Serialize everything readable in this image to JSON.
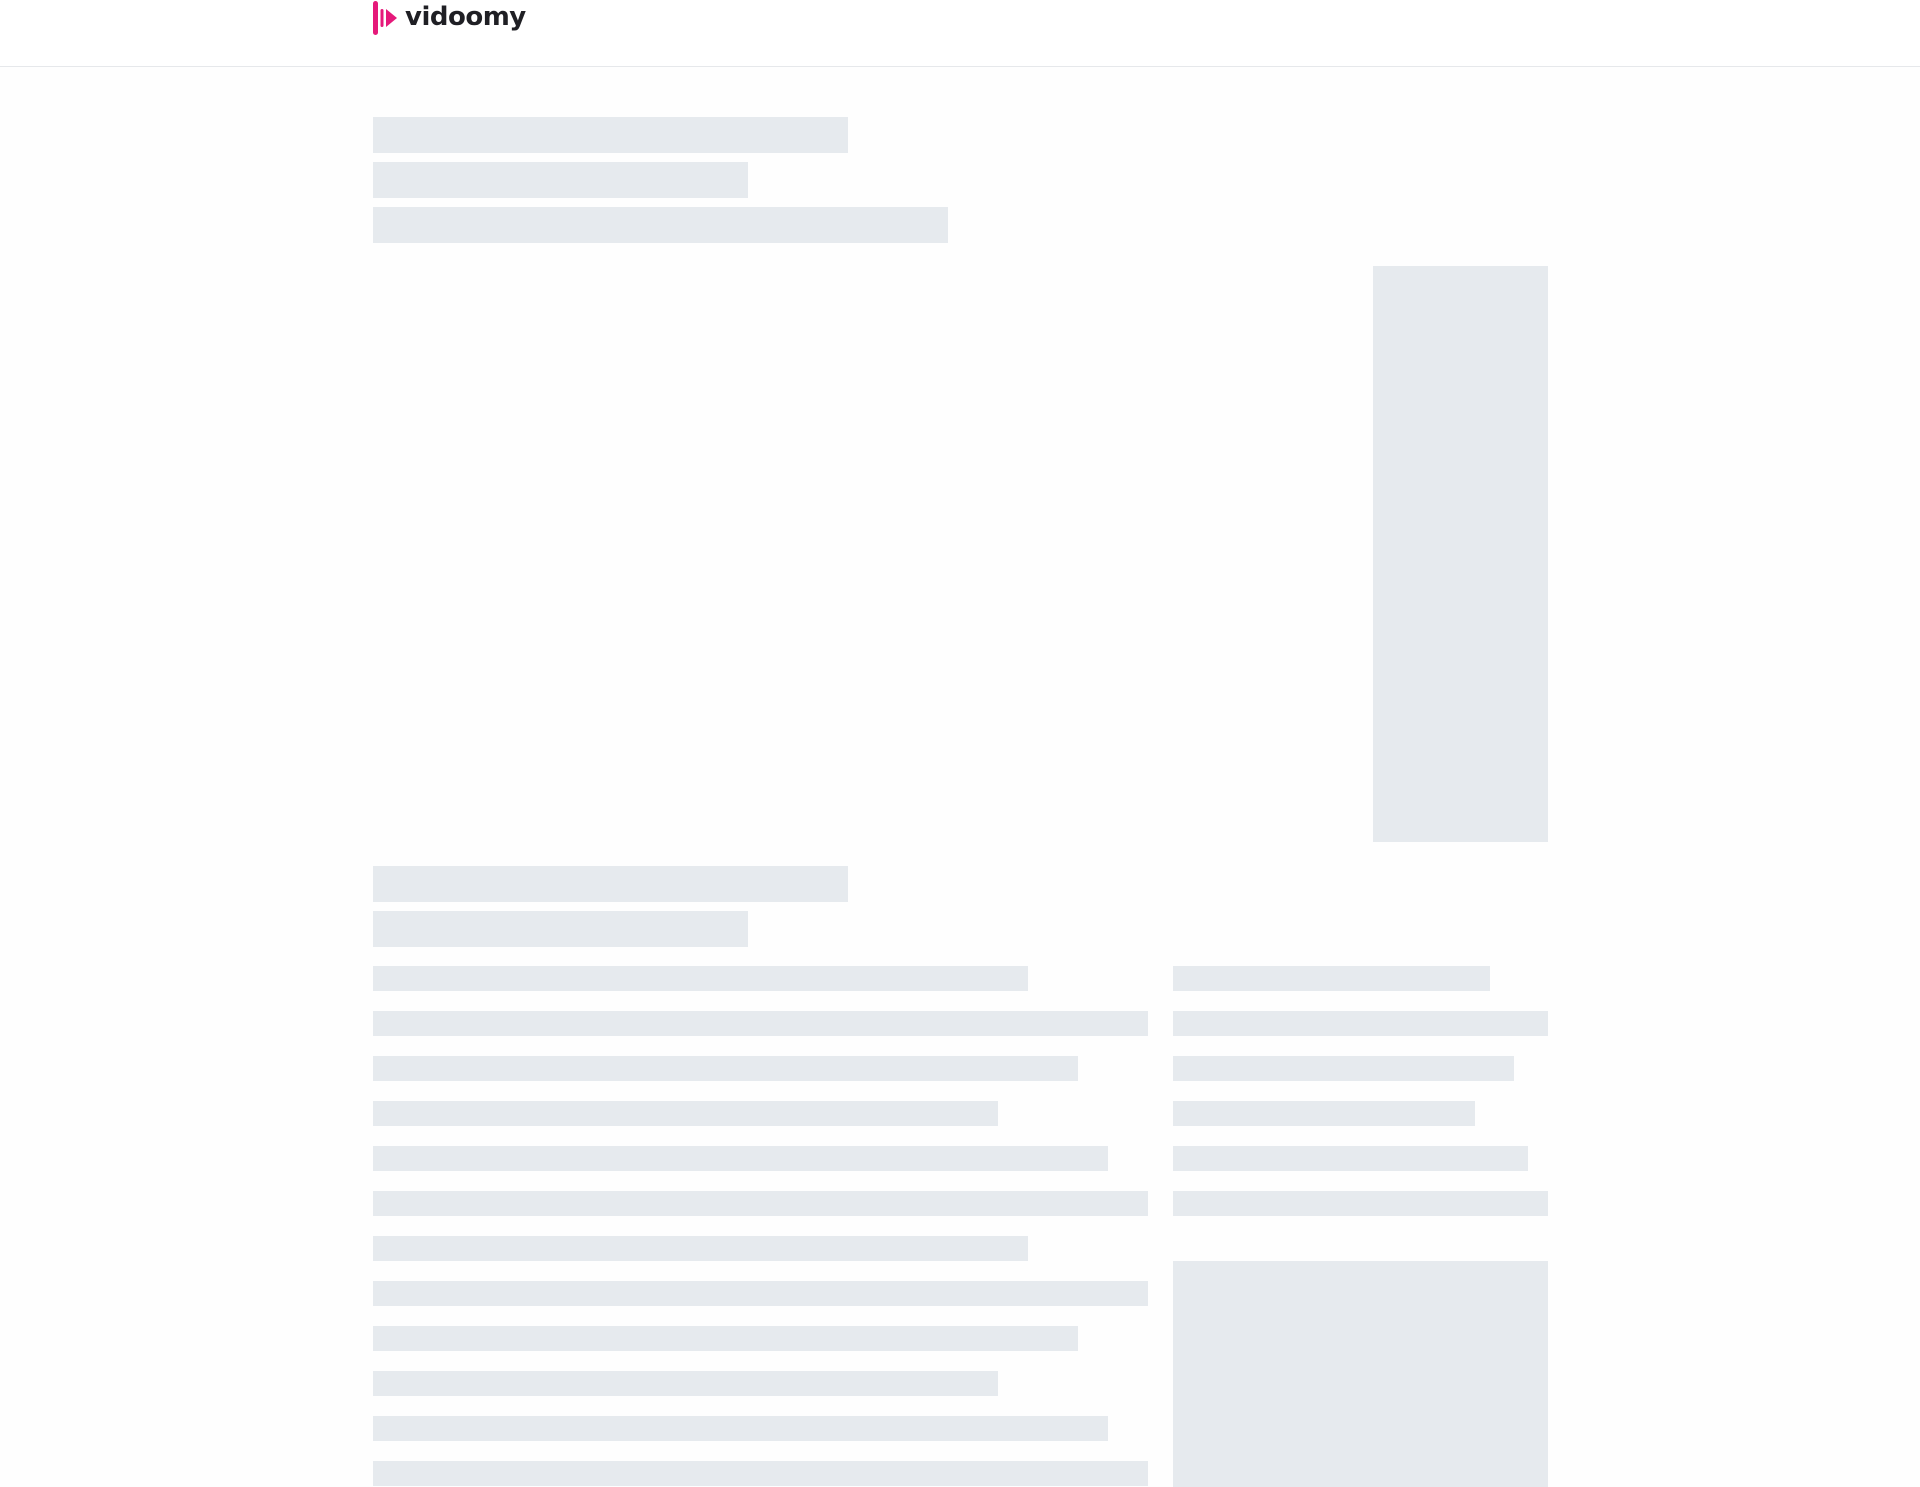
{
  "header": {
    "logo_text": "vidoomy",
    "logo_icon": "vidoomy-play-logo-icon"
  },
  "colors": {
    "brand_pink": "#e5197a",
    "logo_text": "#1f1f24",
    "skeleton": "#e6eaee",
    "divider": "#e6e8eb",
    "background": "#fefefe"
  },
  "page_state": "loading-skeleton"
}
